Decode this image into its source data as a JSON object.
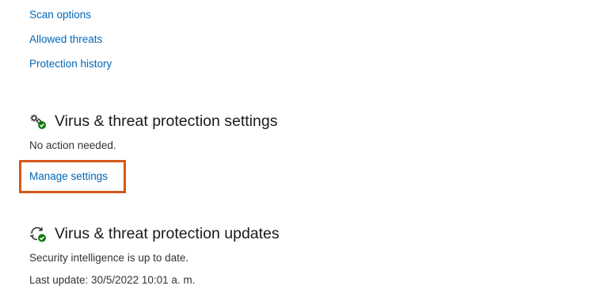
{
  "quick_links": {
    "scan_options": "Scan options",
    "allowed_threats": "Allowed threats",
    "protection_history": "Protection history"
  },
  "settings_section": {
    "icon": "gear-checkmark-icon",
    "title": "Virus & threat protection settings",
    "status": "No action needed.",
    "manage_link": "Manage settings"
  },
  "updates_section": {
    "icon": "refresh-checkmark-icon",
    "title": "Virus & threat protection updates",
    "status": "Security intelligence is up to date.",
    "last_update": "Last update: 30/5/2022 10:01 a. m."
  },
  "colors": {
    "link": "#0067b8",
    "highlight": "#d4581a",
    "status_ok": "#107c10"
  }
}
